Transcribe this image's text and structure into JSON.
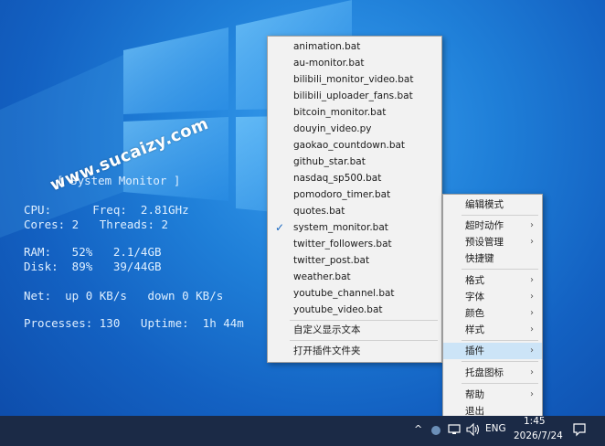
{
  "watermark": "www.sucaizy.com",
  "monitor": {
    "lines": [
      "[ System Monitor ]",
      "CPU:      Freq:  2.81GHz",
      "Cores: 2   Threads: 2",
      "RAM:   52%   2.1/4GB",
      "Disk:  89%   39/44GB",
      "Net:  up 0 KB/s   down 0 KB/s",
      "Processes: 130   Uptime:  1h 44m"
    ]
  },
  "plugin_menu": {
    "items": [
      {
        "label": "animation.bat"
      },
      {
        "label": "au-monitor.bat"
      },
      {
        "label": "bilibili_monitor_video.bat"
      },
      {
        "label": "bilibili_uploader_fans.bat"
      },
      {
        "label": "bitcoin_monitor.bat"
      },
      {
        "label": "douyin_video.py"
      },
      {
        "label": "gaokao_countdown.bat"
      },
      {
        "label": "github_star.bat"
      },
      {
        "label": "nasdaq_sp500.bat"
      },
      {
        "label": "pomodoro_timer.bat"
      },
      {
        "label": "quotes.bat"
      },
      {
        "label": "system_monitor.bat",
        "checked": true
      },
      {
        "label": "twitter_followers.bat"
      },
      {
        "label": "twitter_post.bat"
      },
      {
        "label": "weather.bat"
      },
      {
        "label": "youtube_channel.bat"
      },
      {
        "label": "youtube_video.bat"
      }
    ],
    "custom_text": "自定义显示文本",
    "open_folder": "打开插件文件夹"
  },
  "main_menu": {
    "edit_mode": "编辑模式",
    "timeout_action": "超时动作",
    "preset_manage": "预设管理",
    "hotkey": "快捷键",
    "format": "格式",
    "font": "字体",
    "color": "颜色",
    "style": "样式",
    "plugins": "插件",
    "tray_icon": "托盘图标",
    "help": "帮助",
    "exit": "退出",
    "check_mark": "✓",
    "submenu_arrow": "›"
  },
  "taskbar": {
    "language": "ENG",
    "time": "1:45",
    "date": "2026/7/24",
    "show_hidden": "^",
    "volume_icon": "speaker-icon",
    "network_icon": "network-icon"
  }
}
